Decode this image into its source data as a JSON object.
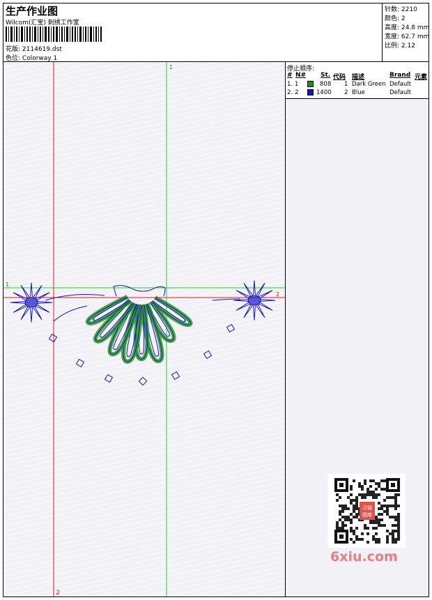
{
  "header": {
    "title": "生产作业图",
    "company": "Wilcom(汇宝) 刺绣工作室",
    "design_label": "花版:",
    "design_file": "2114619.dst",
    "colorway_label": "色位:",
    "colorway": "Colorway 1"
  },
  "stats": [
    {
      "label": "针数:",
      "value": "2210"
    },
    {
      "label": "颜色:",
      "value": "2"
    },
    {
      "label": "高度:",
      "value": "24.8 mm"
    },
    {
      "label": "宽度:",
      "value": "62.7 mm"
    },
    {
      "label": "比例:",
      "value": "2.12"
    }
  ],
  "stop_sequence": {
    "title": "停止顺序:",
    "columns": [
      "#",
      "N#",
      "St.",
      "代码",
      "描述",
      "Brand",
      "元素"
    ],
    "rows": [
      {
        "index": "1.",
        "n": "1",
        "stitches": "808",
        "code": "1",
        "description": "Dark Green",
        "brand": "Default",
        "color": "#1e8c1e"
      },
      {
        "index": "2.",
        "n": "2",
        "stitches": "1400",
        "code": "2",
        "description": "Blue",
        "brand": "Default",
        "color": "#1010d0"
      }
    ]
  },
  "guides": {
    "top_marker": "1",
    "left_marker": "1",
    "right_marker": "2",
    "bottom_marker": "2"
  },
  "colors": {
    "green_thread": "#2e9a22",
    "blue_thread": "#1515c8",
    "guide_red": "#e01818",
    "guide_green": "#22d022"
  },
  "watermark": {
    "brand": "6xiu.com",
    "stamp_text": "汉锦图库"
  }
}
